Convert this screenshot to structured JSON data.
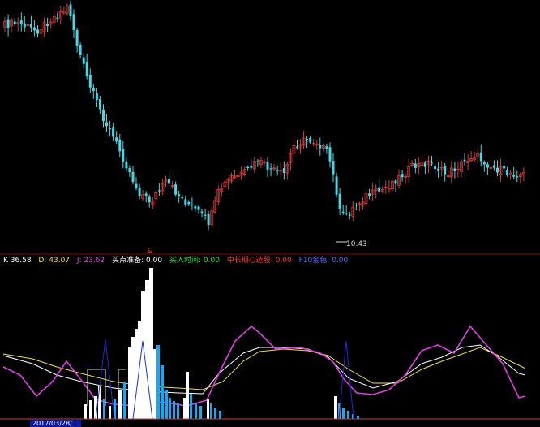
{
  "colors": {
    "background": "#000000",
    "up_candle": "#d23c3c",
    "down_candle": "#45d9e6",
    "panel_divider": "#7a0e0e",
    "k_line": "#ffffff",
    "d_line": "#f2e040",
    "j_line": "#e23ce8",
    "buy_prep_bar": "#ffffff",
    "buy_time_bar": "#1aa7ee",
    "prep_outline": "#dddddd",
    "blue_spike": "#1b2cd6",
    "date_highlight": "#0b1aa8"
  },
  "indicators": {
    "k": {
      "label": "K",
      "value": "36.58",
      "color": "#ffffff"
    },
    "d": {
      "label": "D:",
      "value": "43.07",
      "color": "#f2e040"
    },
    "j": {
      "label": "J:",
      "value": "23.62",
      "color": "#e23ce8"
    },
    "buy_prep": {
      "label": "买点准备:",
      "value": "0.00",
      "color": "#ffffff"
    },
    "buy_time": {
      "label": "买入时间:",
      "value": "0.00",
      "color": "#2ee23c"
    },
    "mid_add": {
      "label": "中长期心选股:",
      "value": "0.00",
      "color": "#ff3a3a"
    },
    "f_key": {
      "label": "F10金色:",
      "value": "0.00",
      "color": "#5566ff"
    }
  },
  "price_annotation": {
    "low_value": "10.43"
  },
  "marker_label": "&",
  "date_label": "2017/03/28/二"
}
